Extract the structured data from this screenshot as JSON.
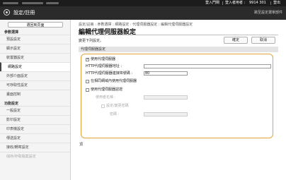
{
  "topbar": {
    "login_link": "登入門閘",
    "user_label": "登入者用者 :",
    "user_value": "9914 301",
    "logout_link": "登出"
  },
  "header": {
    "title": "設定/註冊",
    "shortcut": "跳至設定選單部件"
  },
  "sidebar": {
    "back_label": "選回到頁面",
    "section1": "參數選擇",
    "section2": "功能設定",
    "items_top": [
      {
        "label": "預設設定"
      },
      {
        "label": "顯示設定"
      },
      {
        "label": "裝置器設定"
      },
      {
        "label": "網路設定"
      },
      {
        "label": "外部介面設定"
      },
      {
        "label": "可存取性設定"
      },
      {
        "label": "畫面控制"
      }
    ],
    "items_bottom": [
      {
        "label": "一般設定"
      },
      {
        "label": "影印設定"
      },
      {
        "label": "印表機設定"
      },
      {
        "label": "傳送設定"
      },
      {
        "label": "接收/轉寄設定"
      },
      {
        "label": "儲存/存取檔案設定"
      }
    ]
  },
  "main": {
    "breadcrumb": "設定/註冊 : 參數選擇 : 網路設定 : 代理伺服器設定 : 編輯代理伺服器設定",
    "title": "編輯代理伺服器設定",
    "change_label": "變更下列設定。",
    "ok_label": "確定",
    "cancel_label": "取消",
    "section_label": "代理伺服器設定",
    "use_proxy_label": "使用代理伺服器",
    "http_address_label": "HTTP代理伺服器地址 :",
    "http_address_value": "",
    "http_port_label": "HTTP代理伺服器連接埠號碼 :",
    "http_port_value": "80",
    "same_domain_label": "在相同網域內使用代理伺服器",
    "use_auth_label": "使用代理伺服器認證",
    "username_label": "使用者名稱 :",
    "set_change_password_label": "設定/變更密碼",
    "password_label": "密碼 :",
    "footnote": "頂"
  }
}
